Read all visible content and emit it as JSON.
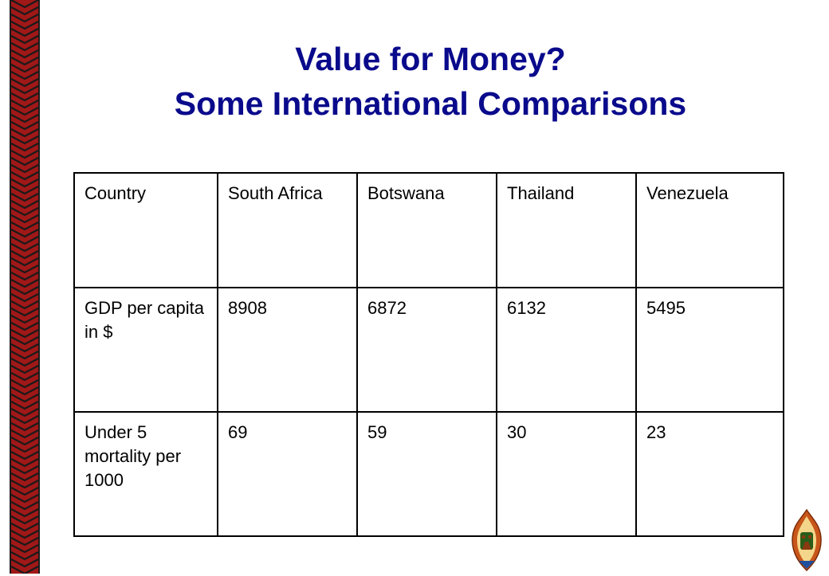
{
  "slide": {
    "title_line1": "Value for Money?",
    "title_line2": "Some International Comparisons"
  },
  "table": {
    "header": [
      "Country",
      "South Africa",
      "Botswana",
      "Thailand",
      "Venezuela"
    ],
    "rows": [
      [
        "GDP per capita in $",
        "8908",
        "6872",
        "6132",
        "5495"
      ],
      [
        "Under 5 mortality per 1000",
        "69",
        "59",
        "30",
        "23"
      ]
    ]
  },
  "colors": {
    "title": "#0a0a8c",
    "border_red": "#a01818",
    "border_dark": "#1a1a1a"
  },
  "icons": {
    "logo": "coat-of-arms-emblem",
    "border": "zigzag-pattern-strip"
  }
}
